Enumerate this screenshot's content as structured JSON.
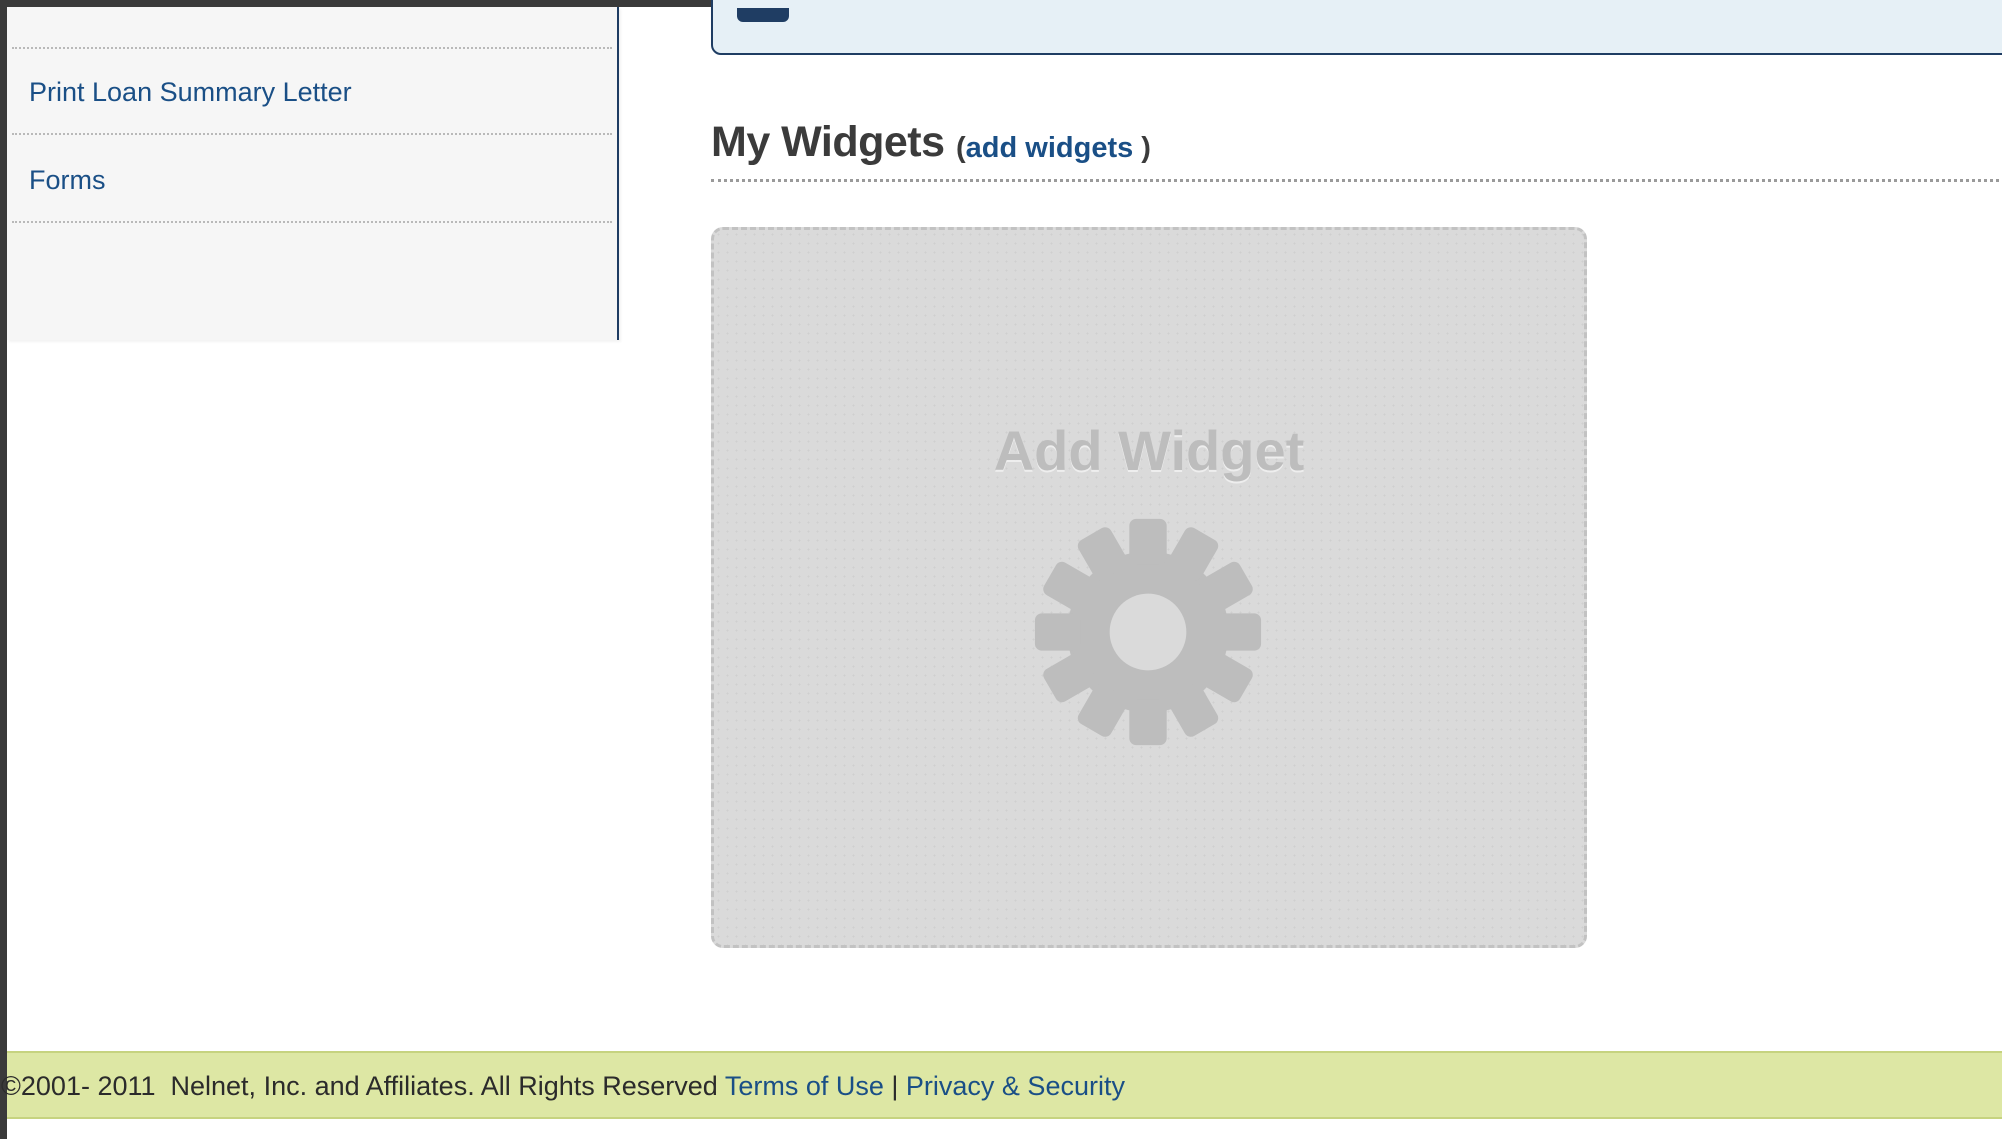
{
  "sidebar": {
    "items": [
      {
        "label": "Print Loan Summary Letter"
      },
      {
        "label": "Forms"
      }
    ]
  },
  "widgets": {
    "title": "My Widgets",
    "add_open": "(",
    "add_link": "add widgets",
    "add_close": " )",
    "card_label": "Add Widget",
    "card_icon": "gear-icon"
  },
  "footer": {
    "copyright": "©2001- 2011  Nelnet, Inc. and Affiliates. All Rights Reserved ",
    "terms": "Terms of Use",
    "separator": " | ",
    "privacy": "Privacy & Security"
  },
  "colors": {
    "link": "#1a4f86",
    "navy": "#1f3d63",
    "footer_bg": "#dde7a4",
    "card_bg": "#dadada"
  }
}
